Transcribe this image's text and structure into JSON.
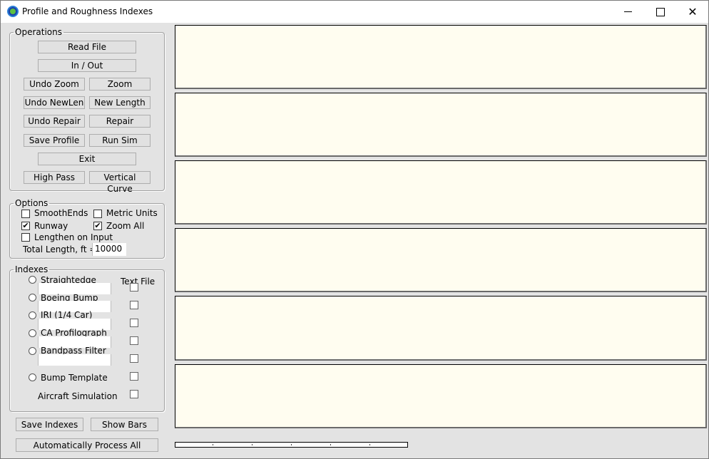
{
  "window": {
    "title": "Profile and Roughness Indexes",
    "icon": "app-globe-icon",
    "controls": {
      "minimize": "minimize-icon",
      "maximize": "maximize-icon",
      "close": "close-icon",
      "close_glyph": "✕"
    }
  },
  "operations": {
    "legend": "Operations",
    "buttons": {
      "read_file": "Read File",
      "in_out": "In / Out",
      "undo_zoom": "Undo Zoom",
      "zoom": "Zoom",
      "undo_newlen": "Undo NewLen",
      "new_length": "New Length",
      "undo_repair": "Undo Repair",
      "repair": "Repair",
      "save_profile": "Save Profile",
      "run_sim": "Run Sim",
      "exit": "Exit",
      "high_pass": "High Pass",
      "vertical_curve": "Vertical Curve"
    }
  },
  "options": {
    "legend": "Options",
    "smooth_ends": {
      "label": "SmoothEnds",
      "checked": false
    },
    "metric_units": {
      "label": "Metric Units",
      "checked": false
    },
    "runway": {
      "label": "Runway",
      "checked": true
    },
    "zoom_all": {
      "label": "Zoom All",
      "checked": true
    },
    "lengthen_on_input": {
      "label": "Lengthen on Input",
      "checked": false
    },
    "total_length_label": "Total Length, ft =",
    "total_length_value": "10000",
    "check_glyph": "✔"
  },
  "indexes": {
    "legend": "Indexes",
    "text_file_header": "Text File",
    "items": [
      {
        "label": "Straightedge",
        "selected": false,
        "text_file": false,
        "has_value_box": true
      },
      {
        "label": "Boeing Bump",
        "selected": false,
        "text_file": false,
        "has_value_box": true
      },
      {
        "label": "IRI (1/4 Car)",
        "selected": false,
        "text_file": false,
        "has_value_box": true
      },
      {
        "label": "CA Profilograph",
        "selected": false,
        "text_file": false,
        "has_value_box": true
      },
      {
        "label": "Bandpass Filter",
        "selected": false,
        "text_file": false,
        "has_value_box": true
      },
      {
        "label": "Bump Template",
        "selected": false,
        "text_file": false,
        "has_value_box": false
      },
      {
        "label": "Aircraft Simulation",
        "selected": null,
        "text_file": false,
        "has_value_box": false
      }
    ]
  },
  "bottom": {
    "save_indexes": "Save Indexes",
    "show_bars": "Show Bars",
    "auto_process": "Automatically Process All"
  },
  "plots": {
    "count": 6,
    "background": "#fffdf0"
  },
  "progress": {
    "value_percent": 0,
    "tick_count": 5
  }
}
